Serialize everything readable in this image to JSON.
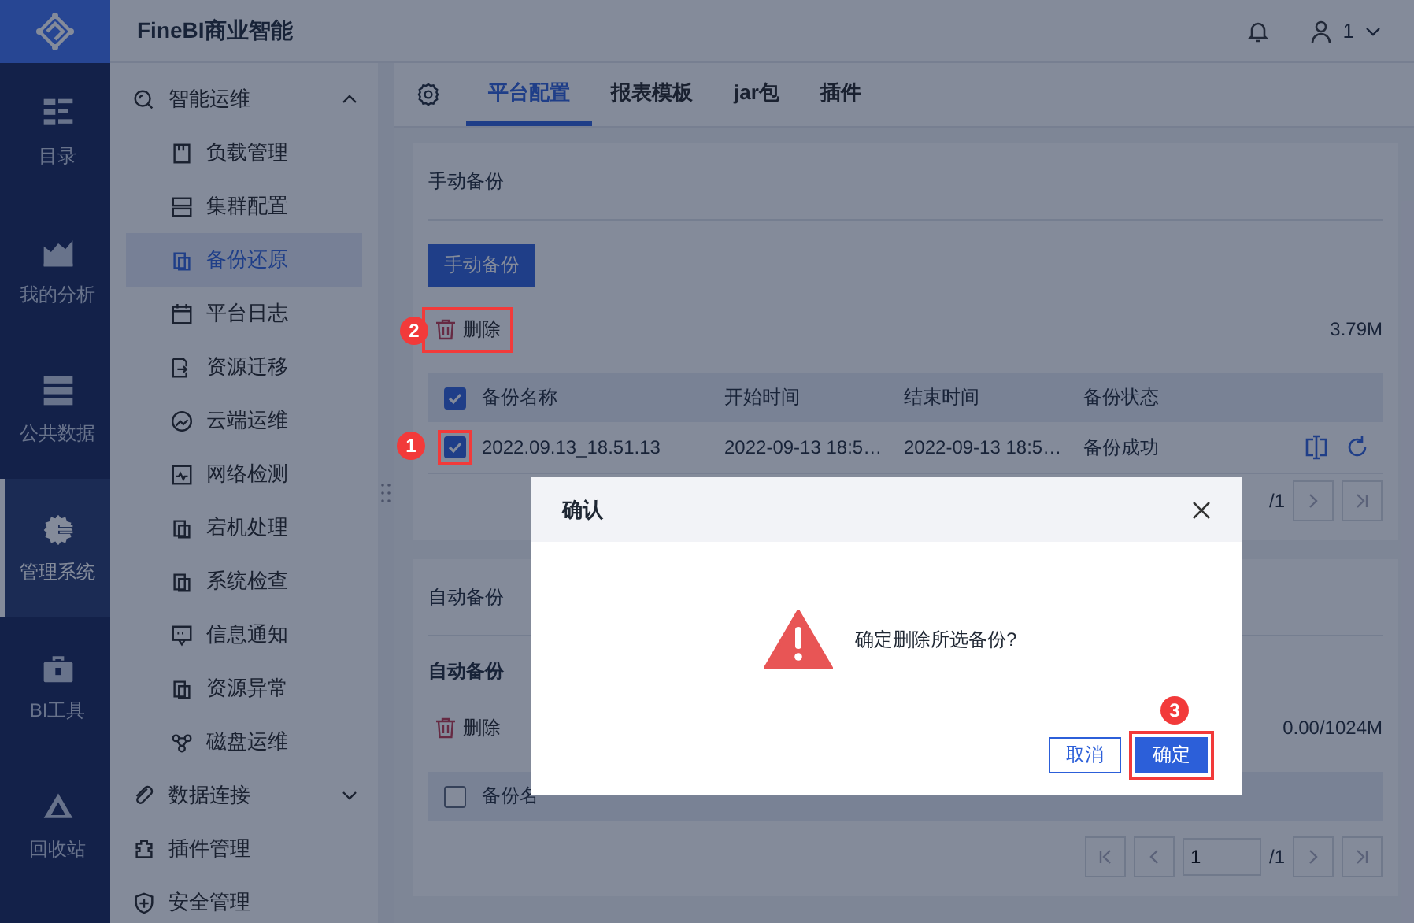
{
  "app": {
    "title": "FineBI商业智能"
  },
  "header": {
    "user": "1"
  },
  "nav": [
    {
      "label": "目录",
      "selected": false
    },
    {
      "label": "我的分析",
      "selected": false
    },
    {
      "label": "公共数据",
      "selected": false
    },
    {
      "label": "管理系统",
      "selected": true
    },
    {
      "label": "BI工具",
      "selected": false
    },
    {
      "label": "回收站",
      "selected": false
    }
  ],
  "menu": [
    {
      "kind": "group",
      "label": "智能运维",
      "expanded": true,
      "children": [
        {
          "label": "负载管理",
          "selected": false
        },
        {
          "label": "集群配置",
          "selected": false
        },
        {
          "label": "备份还原",
          "selected": true
        },
        {
          "label": "平台日志",
          "selected": false
        },
        {
          "label": "资源迁移",
          "selected": false
        },
        {
          "label": "云端运维",
          "selected": false
        },
        {
          "label": "网络检测",
          "selected": false
        },
        {
          "label": "宕机处理",
          "selected": false
        },
        {
          "label": "系统检查",
          "selected": false
        },
        {
          "label": "信息通知",
          "selected": false
        },
        {
          "label": "资源异常",
          "selected": false
        },
        {
          "label": "磁盘运维",
          "selected": false
        }
      ]
    },
    {
      "kind": "group",
      "label": "数据连接",
      "expanded": false
    },
    {
      "kind": "item",
      "label": "插件管理"
    },
    {
      "kind": "item",
      "label": "安全管理"
    }
  ],
  "tabs": [
    {
      "label": "平台配置",
      "selected": true
    },
    {
      "label": "报表模板",
      "selected": false
    },
    {
      "label": "jar包",
      "selected": false
    },
    {
      "label": "插件",
      "selected": false
    }
  ],
  "manual_backup": {
    "title": "手动备份",
    "button": "手动备份",
    "delete": {
      "label": "删除",
      "callout": "2"
    },
    "size": "3.79M",
    "all_checked": true,
    "columns": [
      "备份名称",
      "开始时间",
      "结束时间",
      "备份状态"
    ],
    "rows": [
      {
        "checked": true,
        "callout": "1",
        "cells": [
          "2022.09.13_18.51.13",
          "2022-09-13 18:5…",
          "2022-09-13 18:5…",
          "备份成功"
        ]
      }
    ],
    "pagination": {
      "total": "/1"
    }
  },
  "auto_backup": {
    "title": "自动备份",
    "subtitle": "自动备份",
    "delete": {
      "label": "删除"
    },
    "size": "0.00/1024M",
    "all_checked": false,
    "columns": [
      "备份名"
    ],
    "pagination": {
      "page": "1",
      "total": "/1"
    }
  },
  "dialog": {
    "title": "确认",
    "message": "确定删除所选备份?",
    "buttons": [
      {
        "kind": "secondary",
        "label": "取消"
      },
      {
        "kind": "primary",
        "label": "确定",
        "callout": "3"
      }
    ]
  }
}
